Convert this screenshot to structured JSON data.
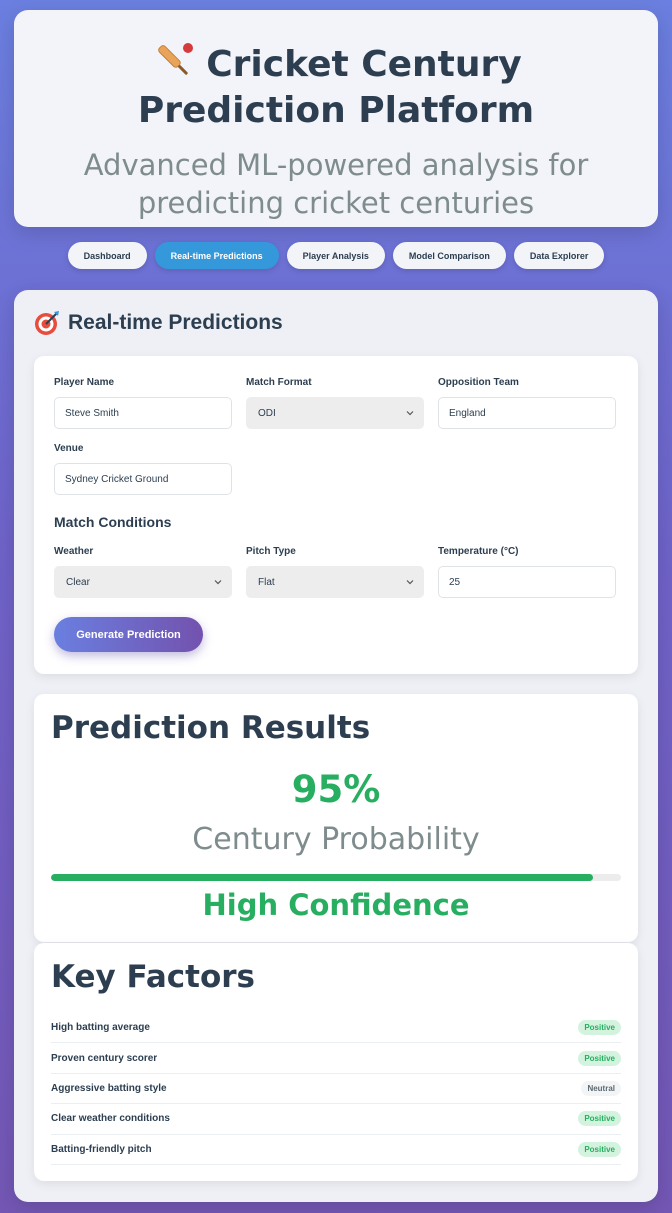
{
  "header": {
    "title": "Cricket Century Prediction Platform",
    "subtitle": "Advanced ML-powered analysis for predicting cricket centuries"
  },
  "nav": {
    "tabs": [
      {
        "label": "Dashboard",
        "active": false
      },
      {
        "label": "Real-time Predictions",
        "active": true
      },
      {
        "label": "Player Analysis",
        "active": false
      },
      {
        "label": "Model Comparison",
        "active": false
      },
      {
        "label": "Data Explorer",
        "active": false
      }
    ]
  },
  "section": {
    "title": "Real-time Predictions"
  },
  "form": {
    "player_name_label": "Player Name",
    "player_name_value": "Steve Smith",
    "match_format_label": "Match Format",
    "match_format_value": "ODI",
    "opposition_label": "Opposition Team",
    "opposition_value": "England",
    "venue_label": "Venue",
    "venue_value": "Sydney Cricket Ground",
    "conditions_heading": "Match Conditions",
    "weather_label": "Weather",
    "weather_value": "Clear",
    "pitch_label": "Pitch Type",
    "pitch_value": "Flat",
    "temperature_label": "Temperature (°C)",
    "temperature_value": "25",
    "generate_button": "Generate Prediction"
  },
  "results": {
    "title": "Prediction Results",
    "probability": "95%",
    "probability_label": "Century Probability",
    "progress": 0.95,
    "confidence": "High Confidence"
  },
  "factors": {
    "title": "Key Factors",
    "items": [
      {
        "name": "High batting average",
        "impact": "Positive"
      },
      {
        "name": "Proven century scorer",
        "impact": "Positive"
      },
      {
        "name": "Aggressive batting style",
        "impact": "Neutral"
      },
      {
        "name": "Clear weather conditions",
        "impact": "Positive"
      },
      {
        "name": "Batting-friendly pitch",
        "impact": "Positive"
      }
    ]
  },
  "colors": {
    "accent": "#3498db",
    "success": "#27ae60",
    "text": "#2c3e50",
    "muted": "#7f8c8d"
  }
}
